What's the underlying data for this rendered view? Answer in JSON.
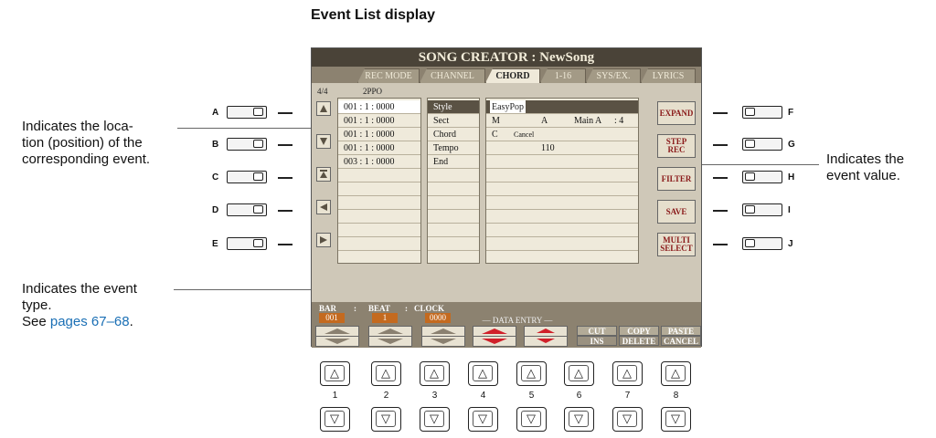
{
  "heading": "Event List display",
  "callouts": {
    "location": "Indicates the loca-\ntion (position) of the\ncorresponding event.",
    "type_line1": "Indicates the event",
    "type_line2": "type.",
    "type_see": "See ",
    "type_pages": "pages 67–68",
    "type_period": ".",
    "value": "Indicates the\nevent value."
  },
  "left_buttons": [
    "A",
    "B",
    "C",
    "D",
    "E"
  ],
  "right_buttons": [
    "F",
    "G",
    "H",
    "I",
    "J"
  ],
  "screen": {
    "title": "SONG CREATOR : NewSong",
    "tabs": [
      "REC MODE",
      "CHANNEL",
      "CHORD",
      "1-16",
      "SYS/EX.",
      "LYRICS"
    ],
    "active_tab": "CHORD",
    "meter": "4/4",
    "ppq": "2PPO",
    "nav_icons": [
      "up-arrow-icon",
      "down-arrow-icon",
      "top-arrow-icon",
      "left-arrow-icon",
      "right-arrow-icon"
    ],
    "rows": [
      {
        "pos": "001 : 1 : 0000",
        "type": "Style",
        "value": "EasyPop",
        "ch": "",
        "v2": "",
        "v3": ""
      },
      {
        "pos": "001 : 1 : 0000",
        "type": "Sect",
        "value": "M",
        "ch": "A",
        "v2": "Main A",
        "v3": ": 4"
      },
      {
        "pos": "001 : 1 : 0000",
        "type": "Chord",
        "value": "C",
        "ch": "Cancel",
        "v2": "",
        "v3": ""
      },
      {
        "pos": "001 : 1 : 0000",
        "type": "Tempo",
        "value": "",
        "ch": "110",
        "v2": "",
        "v3": ""
      },
      {
        "pos": "003 : 1 : 0000",
        "type": "End",
        "value": "",
        "ch": "",
        "v2": "",
        "v3": ""
      }
    ],
    "right_buttons": [
      "EXPAND",
      "STEP\nREC",
      "FILTER",
      "SAVE",
      "MULTI\nSELECT"
    ],
    "bottom": {
      "bar_label": "BAR",
      "beat_label": "BEAT",
      "clock_label": "CLOCK",
      "sep": ":",
      "bar_value": "001",
      "beat_value": "1",
      "clock_value": "0000",
      "data_entry": "— DATA ENTRY —",
      "cut": "CUT",
      "ins": "INS",
      "copy": "COPY",
      "delete": "DELETE",
      "paste": "PASTE",
      "cancel": "CANCEL"
    }
  },
  "number_buttons": [
    "1",
    "2",
    "3",
    "4",
    "5",
    "6",
    "7",
    "8"
  ],
  "colors": {
    "screen_bg": "#cfc8b8",
    "title_bg": "#4a4338",
    "value_orange": "#c46a1f",
    "link": "#1a6fb5"
  }
}
